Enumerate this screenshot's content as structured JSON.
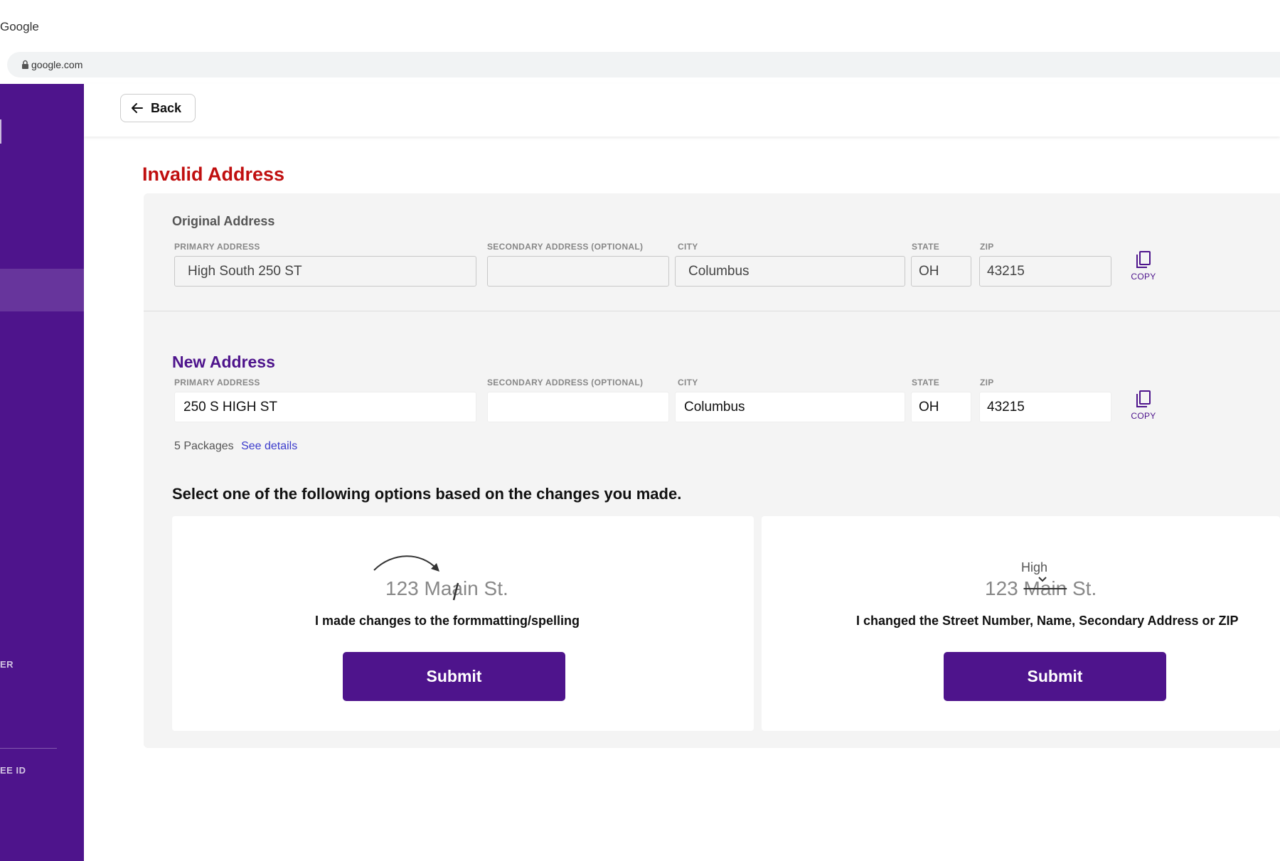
{
  "browser": {
    "tab_title": "Google",
    "url": "google.com"
  },
  "sidebar": {
    "label_1": "ER",
    "label_2": "EE ID"
  },
  "header": {
    "back_label": "Back"
  },
  "page": {
    "title": "Invalid Address"
  },
  "labels": {
    "primary": "PRIMARY ADDRESS",
    "secondary": "SECONDARY ADDRESS (OPTIONAL)",
    "city": "CITY",
    "state": "STATE",
    "zip": "ZIP",
    "copy": "COPY"
  },
  "original": {
    "heading": "Original Address",
    "primary": "High South 250 ST",
    "secondary": "",
    "city": "Columbus",
    "state": "OH",
    "zip": "43215"
  },
  "new_address": {
    "heading": "New Address",
    "primary": "250 S HIGH ST",
    "secondary": "",
    "city": "Columbus",
    "state": "OH",
    "zip": "43215"
  },
  "packages": {
    "text": "5 Packages",
    "link": "See details"
  },
  "instruction": "Select one of the following options based on the changes you made.",
  "options": [
    {
      "illustration_text": "123 Maain St.",
      "description": "I made changes to the formmatting/spelling",
      "submit_label": "Submit"
    },
    {
      "illustration_prefix": "123",
      "illustration_struck": "Main",
      "illustration_suffix": "St.",
      "illustration_insert": "High",
      "description": "I changed the Street Number, Name, Secondary Address or ZIP",
      "submit_label": "Submit"
    }
  ],
  "colors": {
    "brand": "#4e148c",
    "error": "#c00f0f",
    "link": "#3b3bcc"
  }
}
